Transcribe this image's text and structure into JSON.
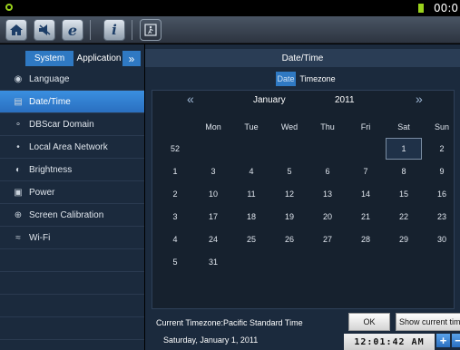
{
  "status_bar": {
    "clock": "00:0"
  },
  "toolbar": {
    "icons": [
      "home-icon",
      "mute-icon",
      "browser-icon",
      "info-icon",
      "exit-icon"
    ]
  },
  "tabs": {
    "system": "System",
    "application": "Application",
    "more": "»"
  },
  "menu": [
    {
      "label": "Language",
      "icon": "globe-icon",
      "glyph": "◉"
    },
    {
      "label": "Date/Time",
      "icon": "calendar-icon",
      "glyph": "▤"
    },
    {
      "label": "DBScar Domain",
      "icon": "network-node-icon",
      "glyph": "∘"
    },
    {
      "label": "Local Area Network",
      "icon": "lan-icon",
      "glyph": "•"
    },
    {
      "label": "Brightness",
      "icon": "brightness-icon",
      "glyph": "◐"
    },
    {
      "label": "Power",
      "icon": "power-icon",
      "glyph": "▣"
    },
    {
      "label": "Screen Calibration",
      "icon": "calibration-icon",
      "glyph": "⊕"
    },
    {
      "label": "Wi-Fi",
      "icon": "wifi-icon",
      "glyph": "≈"
    }
  ],
  "active_menu_index": 1,
  "panel_title": "Date/Time",
  "segment": {
    "date": "Date",
    "timezone": "Timezone"
  },
  "calendar": {
    "prev": "«",
    "next": "»",
    "month": "January",
    "year": "2011",
    "weekdays": [
      "Mon",
      "Tue",
      "Wed",
      "Thu",
      "Fri",
      "Sat",
      "Sun"
    ],
    "weeks": [
      {
        "num": "52",
        "days": [
          "",
          "",
          "",
          "",
          "",
          "1",
          "2"
        ]
      },
      {
        "num": "1",
        "days": [
          "3",
          "4",
          "5",
          "6",
          "7",
          "8",
          "9"
        ]
      },
      {
        "num": "2",
        "days": [
          "10",
          "11",
          "12",
          "13",
          "14",
          "15",
          "16"
        ]
      },
      {
        "num": "3",
        "days": [
          "17",
          "18",
          "19",
          "20",
          "21",
          "22",
          "23"
        ]
      },
      {
        "num": "4",
        "days": [
          "24",
          "25",
          "26",
          "27",
          "28",
          "29",
          "30"
        ]
      },
      {
        "num": "5",
        "days": [
          "31",
          "",
          "",
          "",
          "",
          "",
          ""
        ]
      }
    ],
    "selected_day": "1",
    "selected_date_text": "Saturday, January 1, 2011",
    "time": "12:01:42 AM",
    "plus": "+",
    "minus": "−"
  },
  "timezone_label": "Current Timezone:Pacific Standard Time",
  "buttons": {
    "ok": "OK",
    "show_current_time": "Show current time"
  }
}
